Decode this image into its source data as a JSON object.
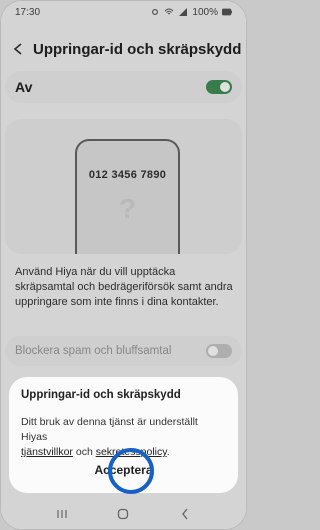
{
  "status_bar": {
    "time": "17:30",
    "battery": "100%"
  },
  "header": {
    "title": "Uppringar-id och skräpskydd"
  },
  "main_toggle": {
    "label": "Av",
    "state": "on"
  },
  "illustration": {
    "phone_number": "012 3456 7890",
    "placeholder_glyph": "?"
  },
  "description": "Använd Hiya när du vill upptäcka skräpsamtal och bedrägeriförsök samt andra uppringare som inte finns i dina kontakter.",
  "block_option": {
    "label": "Blockera spam och bluffsamtal",
    "state": "off"
  },
  "dialog": {
    "title": "Uppringar-id och skräpskydd",
    "body_prefix": "Ditt bruk av denna tjänst är underställt Hiyas",
    "link_terms": "tjänstvillkor",
    "connector": "och",
    "link_privacy": "sekretesspolicy",
    "suffix": ".",
    "accept_label": "Acceptera"
  },
  "colors": {
    "toggle_on": "#3f8f57",
    "highlight_ring": "#1661c6"
  }
}
